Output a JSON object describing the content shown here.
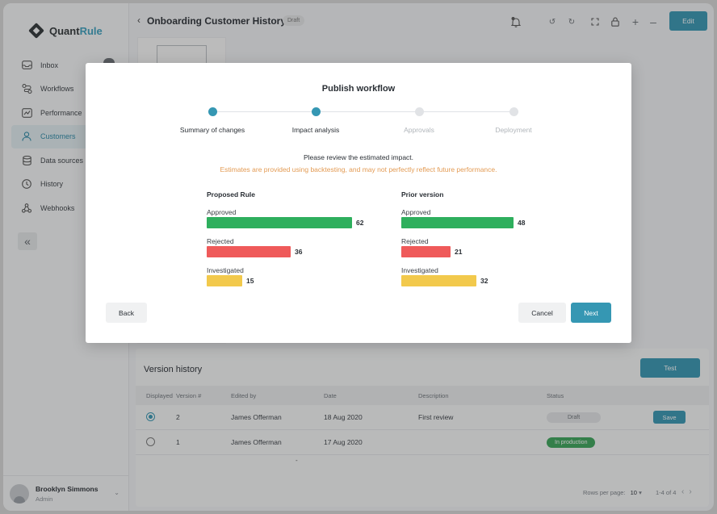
{
  "app": {
    "logo_part1": "Quant",
    "logo_part2": "Rule",
    "page_title": "Onboarding Customer History",
    "draft_badge": "Draft",
    "edit_label": "Edit"
  },
  "sidebar": {
    "items": [
      {
        "label": "Inbox",
        "icon": "inbox-icon"
      },
      {
        "label": "Workflows",
        "icon": "workflow-icon"
      },
      {
        "label": "Performance",
        "icon": "performance-icon"
      },
      {
        "label": "Customers",
        "icon": "user-icon"
      },
      {
        "label": "Data sources",
        "icon": "database-icon"
      },
      {
        "label": "History",
        "icon": "clock-icon"
      },
      {
        "label": "Webhooks",
        "icon": "webhook-icon"
      }
    ],
    "active": "Customers",
    "collapse_glyph": "«",
    "user": {
      "name": "Brooklyn Simmons",
      "role": "Admin"
    }
  },
  "version_history": {
    "title": "Version history",
    "test_label": "Test",
    "columns": [
      "Displayed",
      "Version #",
      "Edited by",
      "Date",
      "Description",
      "Status"
    ],
    "rows": [
      {
        "version": "2",
        "edited_by": "James Offerman",
        "date": "18 Aug 2020",
        "description": "First review",
        "status": "Draft",
        "action": "Save",
        "displayed": true
      },
      {
        "version": "1",
        "edited_by": "James Offerman",
        "date": "17 Aug 2020",
        "description": "",
        "status": "In production",
        "action": "",
        "displayed": false
      }
    ],
    "dash": "-",
    "rows_per_page_label": "Rows per page:",
    "rows_per_page_value": "10",
    "range": "1-4 of 4"
  },
  "modal": {
    "title": "Publish workflow",
    "steps": [
      {
        "label": "Summary of changes",
        "done": true
      },
      {
        "label": "Impact analysis",
        "done": true
      },
      {
        "label": "Approvals",
        "done": false
      },
      {
        "label": "Deployment",
        "done": false
      }
    ],
    "intro": "Please review the estimated impact.",
    "warning": "Estimates are provided using backtesting, and may not perfectly reflect future performance.",
    "colors": {
      "approved": "#2eaf5d",
      "rejected": "#ef5a5a",
      "investigated": "#f2c94c",
      "primary": "#3597b3",
      "warning": "#e39b54"
    },
    "proposed": {
      "title": "Proposed Rule",
      "metrics": [
        {
          "label": "Approved",
          "value": 62
        },
        {
          "label": "Rejected",
          "value": 36
        },
        {
          "label": "Investigated",
          "value": 15
        }
      ]
    },
    "prior": {
      "title": "Prior version",
      "metrics": [
        {
          "label": "Approved",
          "value": 48
        },
        {
          "label": "Rejected",
          "value": 21
        },
        {
          "label": "Investigated",
          "value": 32
        }
      ]
    },
    "back_label": "Back",
    "cancel_label": "Cancel",
    "next_label": "Next"
  }
}
